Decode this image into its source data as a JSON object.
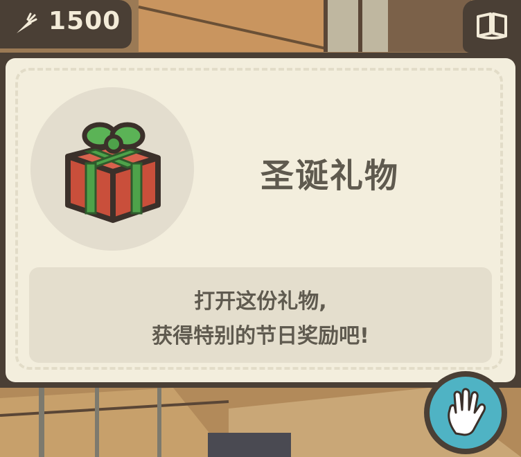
{
  "currency": {
    "icon": "carrot-icon",
    "value": "1500"
  },
  "top_right": {
    "icon": "book-icon"
  },
  "item": {
    "icon": "gift-icon",
    "title": "圣诞礼物",
    "description_line1": "打开这份礼物,",
    "description_line2": "获得特别的节日奖励吧!"
  },
  "action": {
    "icon": "hand-icon"
  },
  "colors": {
    "panel_dark": "#4a3f35",
    "card_bg": "#f3eedd",
    "text": "#5f5a4f",
    "accent_teal": "#4fb3c4",
    "gift_red": "#c94f3b",
    "gift_green": "#4ea24a"
  }
}
